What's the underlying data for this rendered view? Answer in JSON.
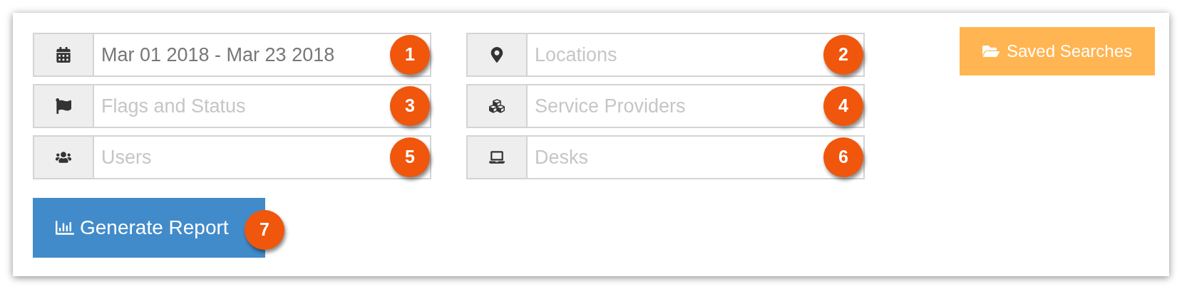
{
  "filters": [
    {
      "value": "Mar 01 2018 - Mar 23 2018",
      "badge": "1"
    },
    {
      "placeholder": "Locations",
      "badge": "2"
    },
    {
      "placeholder": "Flags and Status",
      "badge": "3"
    },
    {
      "placeholder": "Service Providers",
      "badge": "4"
    },
    {
      "placeholder": "Users",
      "badge": "5"
    },
    {
      "placeholder": "Desks",
      "badge": "6"
    }
  ],
  "saved_searches_button": {
    "label": "Saved Searches"
  },
  "generate_button": {
    "label": "Generate Report",
    "badge": "7"
  }
}
